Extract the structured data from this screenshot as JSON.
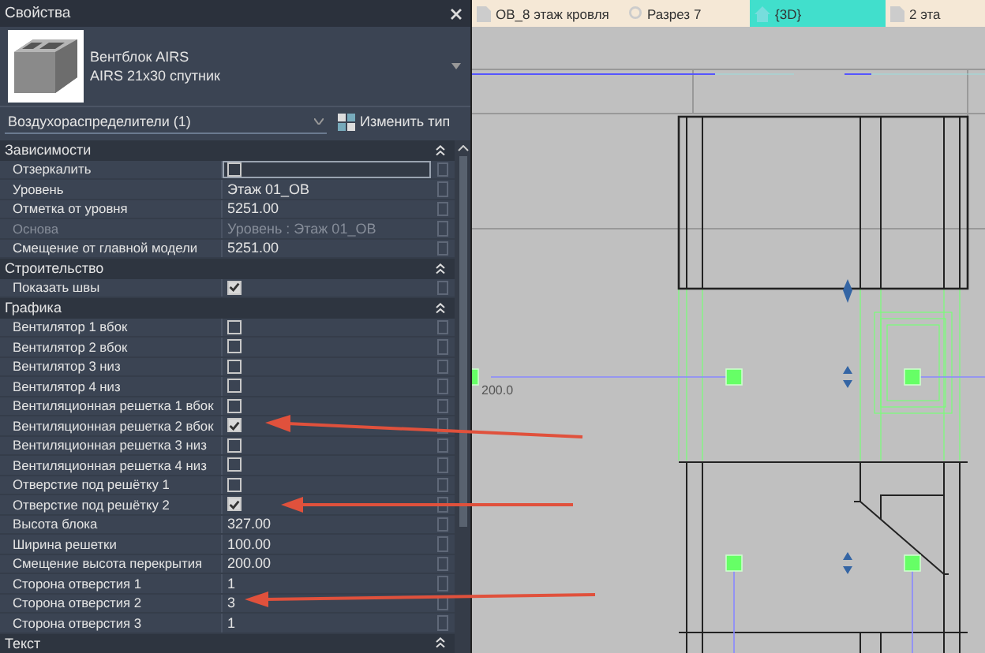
{
  "panel": {
    "title": "Свойства",
    "family": "Вентблок AIRS",
    "type": "AIRS 21x30 спутник",
    "category": "Воздухораспределители (1)",
    "edit_type_button": "Изменить тип",
    "sections": [
      {
        "title": "Зависимости",
        "rows": [
          {
            "label": "Отзеркалить",
            "kind": "check",
            "checked": false,
            "selected": true,
            "disabled": false
          },
          {
            "label": "Уровень",
            "kind": "text",
            "value": "Этаж 01_ОВ",
            "selected": false,
            "disabled": false
          },
          {
            "label": "Отметка от уровня",
            "kind": "text",
            "value": "5251.00",
            "selected": false,
            "disabled": false
          },
          {
            "label": "Основа",
            "kind": "text",
            "value": "Уровень : Этаж 01_ОВ",
            "selected": false,
            "disabled": true
          },
          {
            "label": "Смещение от главной модели",
            "kind": "text",
            "value": "5251.00",
            "selected": false,
            "disabled": false
          }
        ]
      },
      {
        "title": "Строительство",
        "rows": [
          {
            "label": "Показать швы",
            "kind": "check",
            "checked": true,
            "selected": false,
            "disabled": false
          }
        ]
      },
      {
        "title": "Графика",
        "rows": [
          {
            "label": "Вентилятор 1 вбок",
            "kind": "check",
            "checked": false,
            "selected": false,
            "disabled": false
          },
          {
            "label": "Вентилятор 2 вбок",
            "kind": "check",
            "checked": false,
            "selected": false,
            "disabled": false
          },
          {
            "label": "Вентилятор 3 низ",
            "kind": "check",
            "checked": false,
            "selected": false,
            "disabled": false
          },
          {
            "label": "Вентилятор 4 низ",
            "kind": "check",
            "checked": false,
            "selected": false,
            "disabled": false
          },
          {
            "label": "Вентиляционная решетка 1 вбок",
            "kind": "check",
            "checked": false,
            "selected": false,
            "disabled": false
          },
          {
            "label": "Вентиляционная решетка 2 вбок",
            "kind": "check",
            "checked": true,
            "selected": false,
            "disabled": false
          },
          {
            "label": "Вентиляционная решетка 3 низ",
            "kind": "check",
            "checked": false,
            "selected": false,
            "disabled": false
          },
          {
            "label": "Вентиляционная решетка 4 низ",
            "kind": "check",
            "checked": false,
            "selected": false,
            "disabled": false
          },
          {
            "label": "Отверстие под решётку 1",
            "kind": "check",
            "checked": false,
            "selected": false,
            "disabled": false
          },
          {
            "label": "Отверстие под решётку 2",
            "kind": "check",
            "checked": true,
            "selected": false,
            "disabled": false
          },
          {
            "label": "Высота блока",
            "kind": "text",
            "value": "327.00",
            "selected": false,
            "disabled": false
          },
          {
            "label": "Ширина решетки",
            "kind": "text",
            "value": "100.00",
            "selected": false,
            "disabled": false
          },
          {
            "label": "Смещение высота перекрытия",
            "kind": "text",
            "value": "200.00",
            "selected": false,
            "disabled": false
          },
          {
            "label": "Сторона отверстия 1",
            "kind": "text",
            "value": "1",
            "selected": false,
            "disabled": false
          },
          {
            "label": "Сторона отверстия 2",
            "kind": "text",
            "value": "3",
            "selected": false,
            "disabled": false
          },
          {
            "label": "Сторона отверстия 3",
            "kind": "text",
            "value": "1",
            "selected": false,
            "disabled": false
          }
        ]
      },
      {
        "title": "Текст"
      }
    ]
  },
  "view": {
    "tabs": [
      {
        "label": "ОВ_8 этаж кровля",
        "kind": "plan",
        "selected": false
      },
      {
        "label": "Разрез 7",
        "kind": "section",
        "selected": false
      },
      {
        "label": "{3D}",
        "kind": "model",
        "selected": true
      },
      {
        "label": "2 эта",
        "kind": "plan",
        "selected": false
      }
    ],
    "dimension": "200.0"
  }
}
